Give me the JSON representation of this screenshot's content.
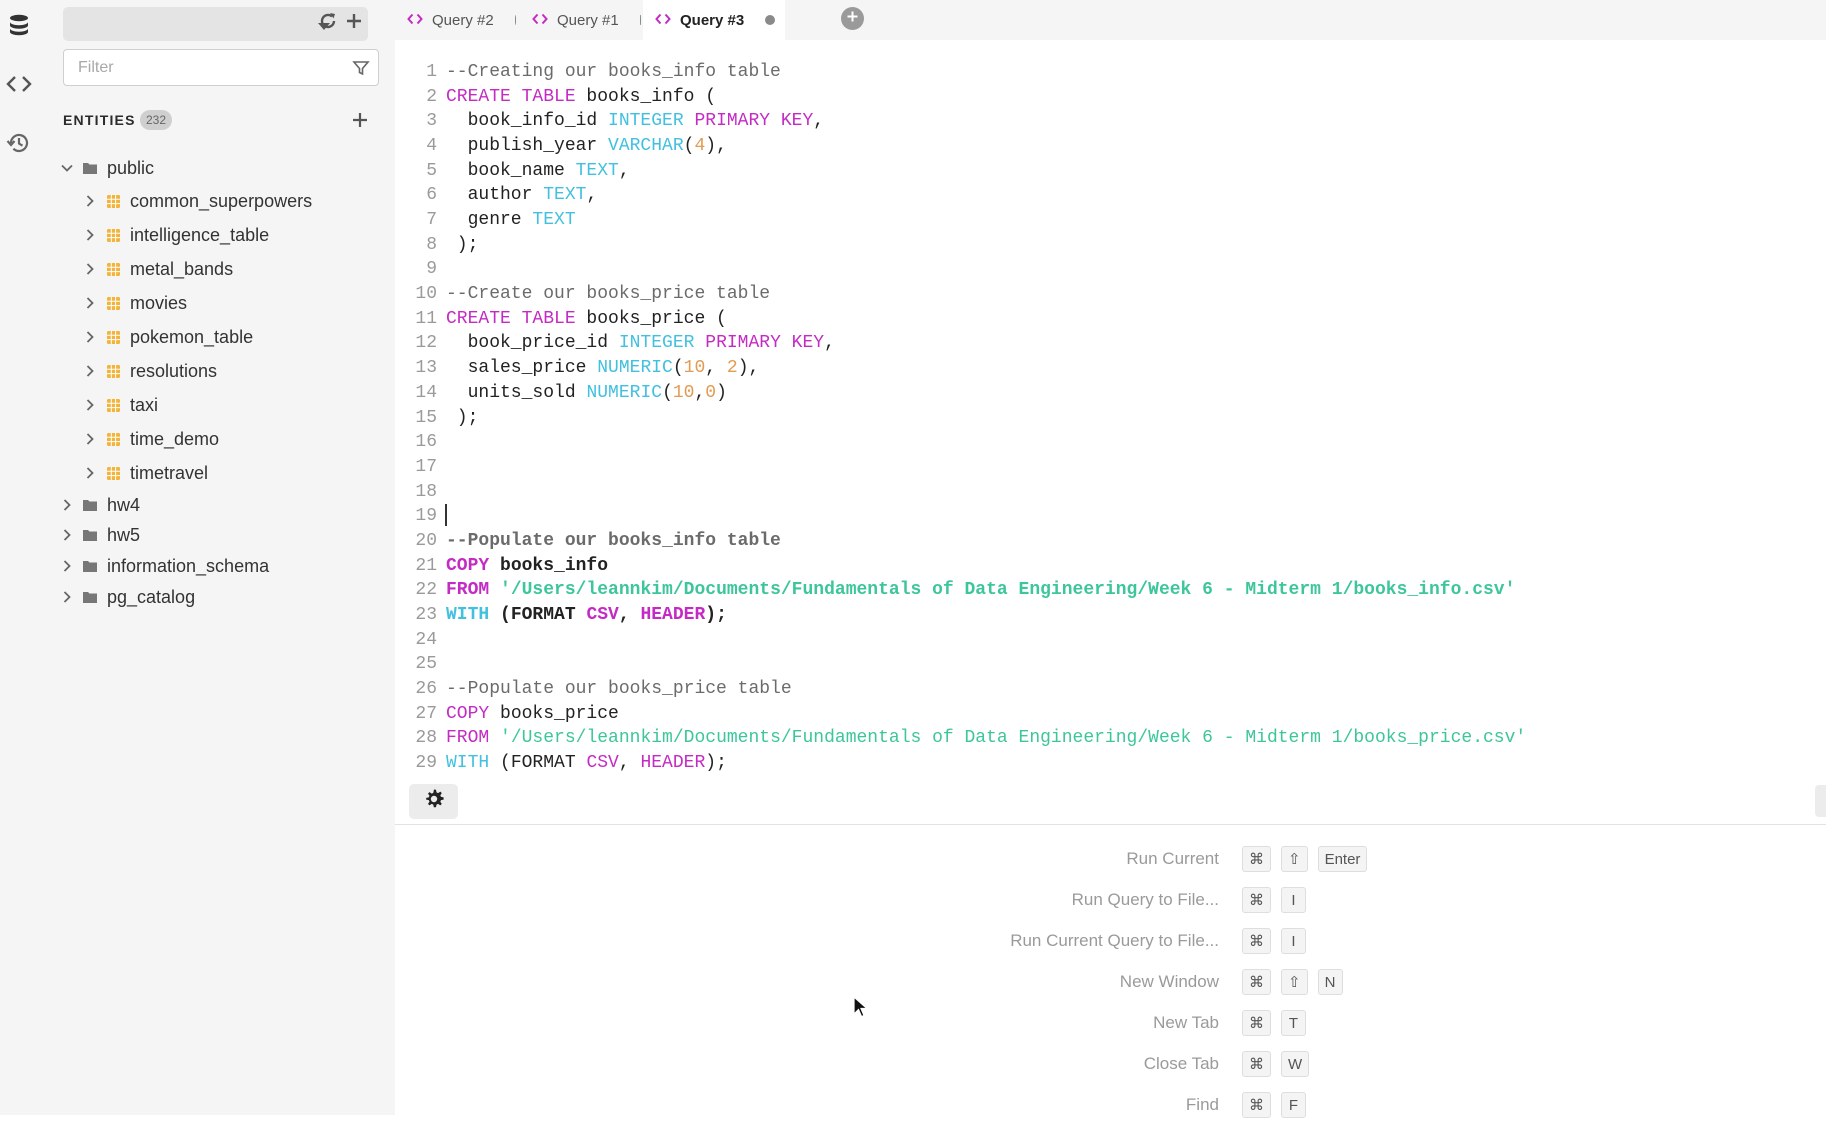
{
  "activity_bar": {
    "icons": [
      "database-icon",
      "code-icon",
      "history-icon"
    ]
  },
  "sidebar": {
    "connection_value": "",
    "filter_placeholder": "Filter",
    "entities_label": "ENTITIES",
    "entities_count": "232",
    "tree": [
      {
        "label": "public",
        "kind": "schema",
        "expanded": true,
        "depth": 0
      },
      {
        "label": "common_superpowers",
        "kind": "table",
        "depth": 1
      },
      {
        "label": "intelligence_table",
        "kind": "table",
        "depth": 1
      },
      {
        "label": "metal_bands",
        "kind": "table",
        "depth": 1
      },
      {
        "label": "movies",
        "kind": "table",
        "depth": 1
      },
      {
        "label": "pokemon_table",
        "kind": "table",
        "depth": 1
      },
      {
        "label": "resolutions",
        "kind": "table",
        "depth": 1
      },
      {
        "label": "taxi",
        "kind": "table",
        "depth": 1
      },
      {
        "label": "time_demo",
        "kind": "table",
        "depth": 1
      },
      {
        "label": "timetravel",
        "kind": "table",
        "depth": 1
      },
      {
        "label": "hw4",
        "kind": "schema",
        "expanded": false,
        "depth": 0
      },
      {
        "label": "hw5",
        "kind": "schema",
        "expanded": false,
        "depth": 0
      },
      {
        "label": "information_schema",
        "kind": "schema",
        "expanded": false,
        "depth": 0
      },
      {
        "label": "pg_catalog",
        "kind": "schema",
        "expanded": false,
        "depth": 0
      }
    ]
  },
  "tabs": [
    {
      "label": "Query #2",
      "active": false
    },
    {
      "label": "Query #1",
      "active": false
    },
    {
      "label": "Query #3",
      "active": true
    }
  ],
  "editor": {
    "lines": [
      [
        [
          "--Creating our books_info table",
          "cm"
        ]
      ],
      [
        [
          "CREATE TABLE",
          "kw"
        ],
        [
          " books_info (",
          ""
        ]
      ],
      [
        [
          "  book_info_id ",
          ""
        ],
        [
          "INTEGER",
          "ty"
        ],
        [
          " ",
          ""
        ],
        [
          "PRIMARY KEY",
          "kw"
        ],
        [
          ",",
          ""
        ]
      ],
      [
        [
          "  publish_year ",
          ""
        ],
        [
          "VARCHAR",
          "ty"
        ],
        [
          "(",
          ""
        ],
        [
          "4",
          "num"
        ],
        [
          "),",
          ""
        ]
      ],
      [
        [
          "  book_name ",
          ""
        ],
        [
          "TEXT",
          "ty"
        ],
        [
          ",",
          ""
        ]
      ],
      [
        [
          "  author ",
          ""
        ],
        [
          "TEXT",
          "ty"
        ],
        [
          ",",
          ""
        ]
      ],
      [
        [
          "  genre ",
          ""
        ],
        [
          "TEXT",
          "ty"
        ]
      ],
      [
        [
          " );",
          ""
        ]
      ],
      [],
      [
        [
          "--Create our books_price table",
          "cm"
        ]
      ],
      [
        [
          "CREATE TABLE",
          "kw"
        ],
        [
          " books_price (",
          ""
        ]
      ],
      [
        [
          "  book_price_id ",
          ""
        ],
        [
          "INTEGER",
          "ty"
        ],
        [
          " ",
          ""
        ],
        [
          "PRIMARY KEY",
          "kw"
        ],
        [
          ",",
          ""
        ]
      ],
      [
        [
          "  sales_price ",
          ""
        ],
        [
          "NUMERIC",
          "ty"
        ],
        [
          "(",
          ""
        ],
        [
          "10",
          "num"
        ],
        [
          ", ",
          ""
        ],
        [
          "2",
          "num"
        ],
        [
          "),",
          ""
        ]
      ],
      [
        [
          "  units_sold ",
          ""
        ],
        [
          "NUMERIC",
          "ty"
        ],
        [
          "(",
          ""
        ],
        [
          "10",
          "num"
        ],
        [
          ",",
          ""
        ],
        [
          "0",
          "num"
        ],
        [
          ")",
          ""
        ]
      ],
      [
        [
          " );",
          ""
        ]
      ],
      [],
      [],
      [],
      [],
      [
        [
          "--Populate our books_info table",
          "cm bold"
        ]
      ],
      [
        [
          "COPY",
          "kw bold"
        ],
        [
          " books_info",
          "bold"
        ]
      ],
      [
        [
          "FROM",
          "kw bold"
        ],
        [
          " ",
          ""
        ],
        [
          "'/Users/leannkim/Documents/Fundamentals of Data Engineering/Week 6 - Midterm 1/books_info.csv'",
          "str bold"
        ]
      ],
      [
        [
          "WITH",
          "ty bold"
        ],
        [
          " (FORMAT ",
          "bold"
        ],
        [
          "CSV",
          "kw bold"
        ],
        [
          ", ",
          "bold"
        ],
        [
          "HEADER",
          "kw bold"
        ],
        [
          ");",
          "bold"
        ]
      ],
      [],
      [],
      [
        [
          "--Populate our books_price table",
          "cm"
        ]
      ],
      [
        [
          "COPY",
          "kw"
        ],
        [
          " books_price",
          ""
        ]
      ],
      [
        [
          "FROM",
          "kw"
        ],
        [
          " ",
          ""
        ],
        [
          "'/Users/leannkim/Documents/Fundamentals of Data Engineering/Week 6 - Midterm 1/books_price.csv'",
          "str"
        ]
      ],
      [
        [
          "WITH",
          "ty"
        ],
        [
          " (FORMAT ",
          ""
        ],
        [
          "CSV",
          "kw"
        ],
        [
          ", ",
          ""
        ],
        [
          "HEADER",
          "kw"
        ],
        [
          ");",
          ""
        ]
      ]
    ]
  },
  "shortcuts": [
    {
      "label": "Run Current",
      "keys": [
        "⌘",
        "⇧",
        "Enter"
      ]
    },
    {
      "label": "Run Query to File...",
      "keys": [
        "⌘",
        "I"
      ]
    },
    {
      "label": "Run Current Query to File...",
      "keys": [
        "⌘",
        "I"
      ]
    },
    {
      "label": "New Window",
      "keys": [
        "⌘",
        "⇧",
        "N"
      ]
    },
    {
      "label": "New Tab",
      "keys": [
        "⌘",
        "T"
      ]
    },
    {
      "label": "Close Tab",
      "keys": [
        "⌘",
        "W"
      ]
    },
    {
      "label": "Find",
      "keys": [
        "⌘",
        "F"
      ]
    }
  ],
  "colors": {
    "keyword": "#c42bc4",
    "type": "#42c0e0",
    "number": "#e39b52",
    "string": "#3dc69b",
    "comment": "#6b6b6b",
    "tab_accent": "#c42bc4",
    "table_icon": "#f2b43c"
  }
}
